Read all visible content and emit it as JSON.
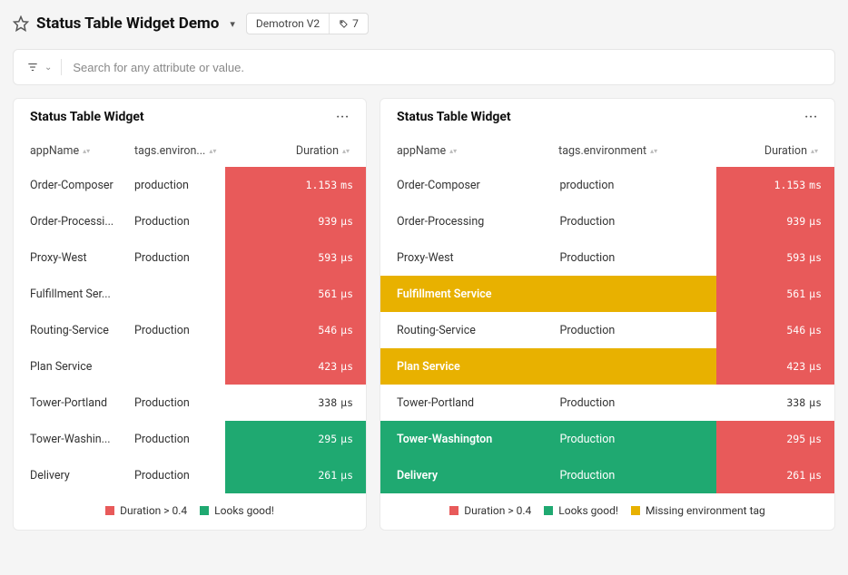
{
  "header": {
    "title": "Status Table Widget Demo",
    "project_label": "Demotron V2",
    "tag_count": "7"
  },
  "search": {
    "placeholder": "Search for any attribute or value."
  },
  "columns": {
    "name": "appName",
    "env_short": "tags.environ...",
    "env_full": "tags.environment",
    "duration": "Duration"
  },
  "panel1": {
    "title": "Status Table Widget",
    "rows": [
      {
        "name": "Order-Composer",
        "env": "production",
        "dur": "1.153",
        "unit": "ms",
        "chip": "red"
      },
      {
        "name": "Order-Processi...",
        "env": "Production",
        "dur": "939",
        "unit": "µs",
        "chip": "red"
      },
      {
        "name": "Proxy-West",
        "env": "Production",
        "dur": "593",
        "unit": "µs",
        "chip": "red"
      },
      {
        "name": "Fulfillment Ser...",
        "env": "",
        "dur": "561",
        "unit": "µs",
        "chip": "red"
      },
      {
        "name": "Routing-Service",
        "env": "Production",
        "dur": "546",
        "unit": "µs",
        "chip": "red"
      },
      {
        "name": "Plan Service",
        "env": "",
        "dur": "423",
        "unit": "µs",
        "chip": "red"
      },
      {
        "name": "Tower-Portland",
        "env": "Production",
        "dur": "338",
        "unit": "µs",
        "chip": "plain"
      },
      {
        "name": "Tower-Washin...",
        "env": "Production",
        "dur": "295",
        "unit": "µs",
        "chip": "green"
      },
      {
        "name": "Delivery",
        "env": "Production",
        "dur": "261",
        "unit": "µs",
        "chip": "green"
      }
    ],
    "legend": [
      {
        "label": "Duration > 0.4",
        "color": "red"
      },
      {
        "label": "Looks good!",
        "color": "green"
      }
    ]
  },
  "panel2": {
    "title": "Status Table Widget",
    "rows": [
      {
        "name": "Order-Composer",
        "env": "production",
        "dur": "1.153",
        "unit": "ms",
        "chip": "red",
        "row": ""
      },
      {
        "name": "Order-Processing",
        "env": "Production",
        "dur": "939",
        "unit": "µs",
        "chip": "red",
        "row": ""
      },
      {
        "name": "Proxy-West",
        "env": "Production",
        "dur": "593",
        "unit": "µs",
        "chip": "red",
        "row": ""
      },
      {
        "name": "Fulfillment Service",
        "env": "",
        "dur": "561",
        "unit": "µs",
        "chip": "red",
        "row": "yellow"
      },
      {
        "name": "Routing-Service",
        "env": "Production",
        "dur": "546",
        "unit": "µs",
        "chip": "red",
        "row": ""
      },
      {
        "name": "Plan Service",
        "env": "",
        "dur": "423",
        "unit": "µs",
        "chip": "red",
        "row": "yellow"
      },
      {
        "name": "Tower-Portland",
        "env": "Production",
        "dur": "338",
        "unit": "µs",
        "chip": "plain",
        "row": ""
      },
      {
        "name": "Tower-Washington",
        "env": "Production",
        "dur": "295",
        "unit": "µs",
        "chip": "red",
        "row": "green"
      },
      {
        "name": "Delivery",
        "env": "Production",
        "dur": "261",
        "unit": "µs",
        "chip": "red",
        "row": "green"
      }
    ],
    "legend": [
      {
        "label": "Duration > 0.4",
        "color": "red"
      },
      {
        "label": "Looks good!",
        "color": "green"
      },
      {
        "label": "Missing environment tag",
        "color": "yellow"
      }
    ]
  }
}
